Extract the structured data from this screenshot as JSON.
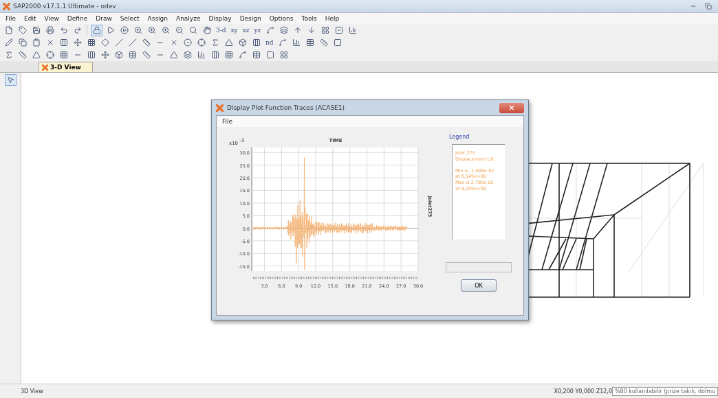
{
  "window": {
    "title": "SAP2000 v17.1.1 Ultimate  - odev"
  },
  "menu": [
    "File",
    "Edit",
    "View",
    "Define",
    "Draw",
    "Select",
    "Assign",
    "Analyze",
    "Display",
    "Design",
    "Options",
    "Tools",
    "Help"
  ],
  "toolbar_text_buttons": [
    "3-d",
    "xy",
    "xz",
    "yz"
  ],
  "toolbar2_text_button": "nd",
  "tabs": [
    {
      "label": "3-D View",
      "selected": true
    }
  ],
  "dialog": {
    "title": "Display Plot Function Traces  (ACASE1)",
    "menu": [
      "File"
    ],
    "chart": {
      "title": "TIME",
      "exponent": "x10",
      "exponent_power": "-3",
      "right_label": "Joint275",
      "yticks": [
        "30.0",
        "25.0",
        "20.0",
        "15.0",
        "10.0",
        "5.0",
        "0.0",
        "-5.0",
        "-10.0",
        "-15.0"
      ],
      "xticks": [
        "3.0",
        "6.0",
        "9.0",
        "12.0",
        "15.0",
        "18.0",
        "21.0",
        "24.0",
        "27.0",
        "30.0"
      ]
    },
    "legend": {
      "title": "Legend",
      "groups": [
        [
          "Joint 275",
          "Displacement UX"
        ],
        [
          "Min is -1,088e-02",
          "at 8,545e+00",
          "Max is 2,790e-02",
          "at 9,205e+00"
        ]
      ]
    },
    "ok_button": "OK"
  },
  "status_bar": {
    "left": "3D View",
    "coordinates": "X0,200  Y0,000  Z12,0",
    "tooltip": "%80 kullanılabilir (prize takılı, dolmu"
  }
}
